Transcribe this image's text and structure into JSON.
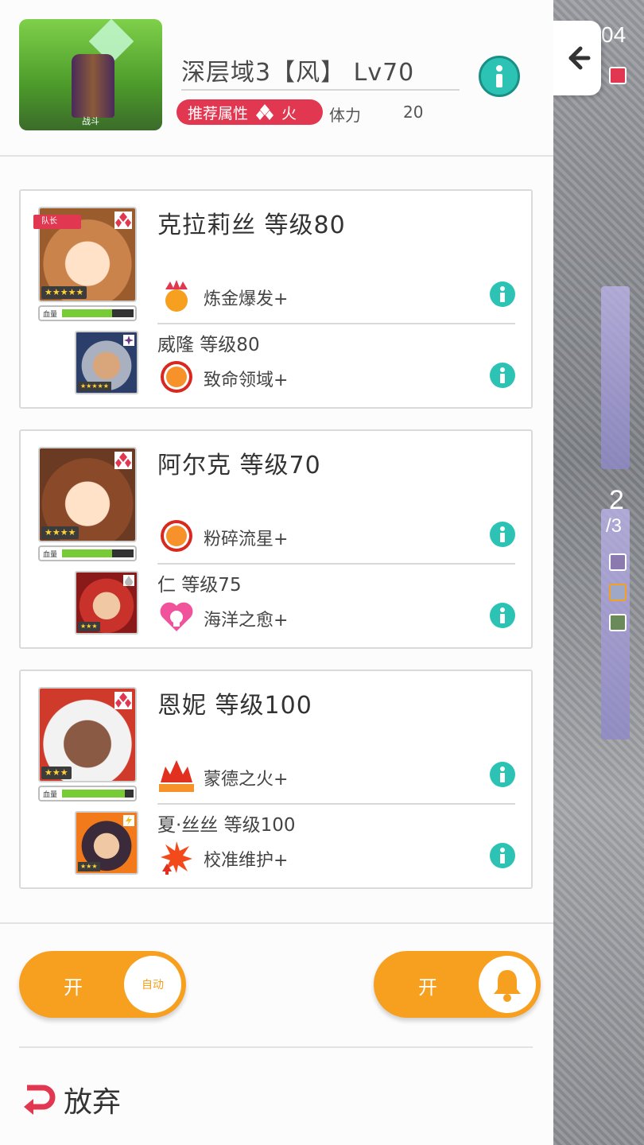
{
  "stage": {
    "thumbnail_label": "战斗",
    "title": "深层域3【风】 Lv70",
    "recommend_label": "推荐属性",
    "recommend_attribute": "火",
    "stamina_label": "体力",
    "stamina_value": "20"
  },
  "side": {
    "top_number": "04",
    "wave_current": "2",
    "wave_total": "/3"
  },
  "team": [
    {
      "leader_tag": "队长",
      "stars": "★★★★★",
      "hp_label": "血量",
      "hp_fraction": 0.7,
      "name": "克拉莉丝 等级80",
      "skill": "炼金爆发+",
      "sub_stars": "★★★★★",
      "sub_name": "威隆 等级80",
      "sub_skill": "致命领域+"
    },
    {
      "stars": "★★★★",
      "hp_label": "血量",
      "hp_fraction": 0.7,
      "name": "阿尔克 等级70",
      "skill": "粉碎流星+",
      "sub_stars": "★★★",
      "sub_name": "仁 等级75",
      "sub_skill": "海洋之愈+"
    },
    {
      "stars": "★★★",
      "hp_label": "血量",
      "hp_fraction": 0.88,
      "name": "恩妮 等级100",
      "skill": "蒙德之火+",
      "sub_stars": "★★★",
      "sub_name": "夏·丝丝 等级100",
      "sub_skill": "校准维护+"
    }
  ],
  "controls": {
    "auto_toggle_state": "开",
    "auto_knob_label": "自动",
    "notify_toggle_state": "开",
    "abandon_label": "放弃"
  },
  "colors": {
    "accent_orange": "#f7a020",
    "info_teal": "#2cc3b5",
    "fire_red": "#e23750",
    "hp_green": "#77cc35"
  }
}
